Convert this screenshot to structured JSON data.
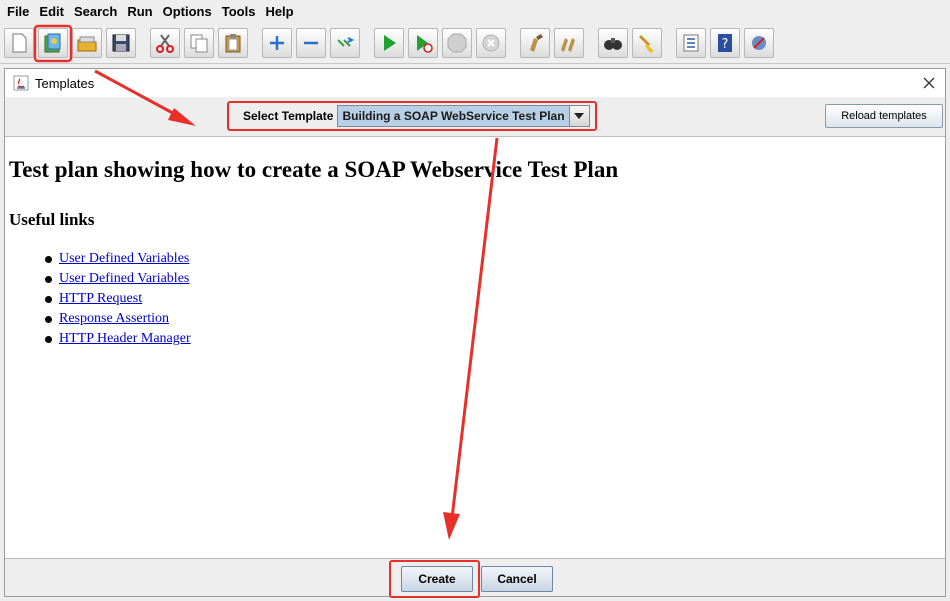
{
  "menu": [
    {
      "name": "menu-file",
      "label": "File"
    },
    {
      "name": "menu-edit",
      "label": "Edit"
    },
    {
      "name": "menu-search",
      "label": "Search"
    },
    {
      "name": "menu-run",
      "label": "Run"
    },
    {
      "name": "menu-options",
      "label": "Options"
    },
    {
      "name": "menu-tools",
      "label": "Tools"
    },
    {
      "name": "menu-help",
      "label": "Help"
    }
  ],
  "toolbar": {
    "icons": [
      "new-icon",
      "templates-icon",
      "open-icon",
      "save-icon",
      "cut-icon",
      "copy-icon",
      "paste-icon",
      "expand-icon",
      "collapse-icon",
      "toggle-icon",
      "start-icon",
      "start-no-pause-icon",
      "stop-icon",
      "shutdown-icon",
      "clear-icon",
      "clear-all-icon",
      "search-icon",
      "reset-search-icon",
      "function-helper-icon",
      "help-icon",
      "remote-icon"
    ]
  },
  "dialog": {
    "title": "Templates",
    "select_label": "Select Template",
    "select_value": "Building a SOAP WebService Test Plan",
    "reload_label": "Reload templates",
    "heading": "Test plan showing how to create a SOAP Webservice Test Plan",
    "subheading": "Useful links",
    "links": [
      "User Defined Variables",
      "User Defined Variables",
      "HTTP Request",
      "Response Assertion",
      "HTTP Header Manager"
    ],
    "create_label": "Create",
    "cancel_label": "Cancel"
  },
  "colors": {
    "annotation_red": "#e8302a",
    "link_blue": "#0000cc",
    "select_bg": "#b8cfe5"
  }
}
